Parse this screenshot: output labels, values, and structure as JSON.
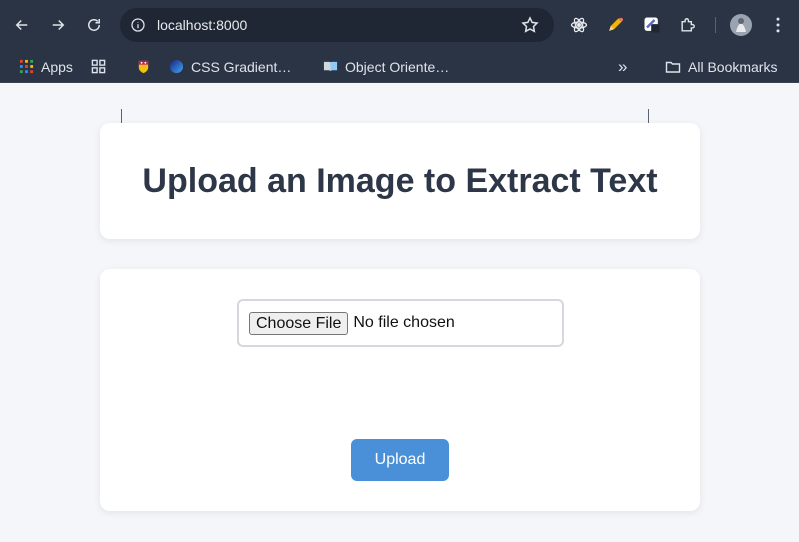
{
  "browser": {
    "url": "localhost:8000",
    "bookmarks": {
      "apps_label": "Apps",
      "items": [
        {
          "label": "CSS Gradient…"
        },
        {
          "label": "Object Oriente…"
        }
      ],
      "overflow": "»",
      "all_bookmarks": "All Bookmarks"
    }
  },
  "page": {
    "title": "Upload an Image to Extract Text",
    "file_input": {
      "button_label": "Choose File",
      "status": "No file chosen"
    },
    "upload_label": "Upload"
  },
  "colors": {
    "chrome_bg": "#2b3445",
    "page_bg": "#f4f6f9",
    "title_text": "#2d3748",
    "upload_button": "#4a90d9"
  }
}
